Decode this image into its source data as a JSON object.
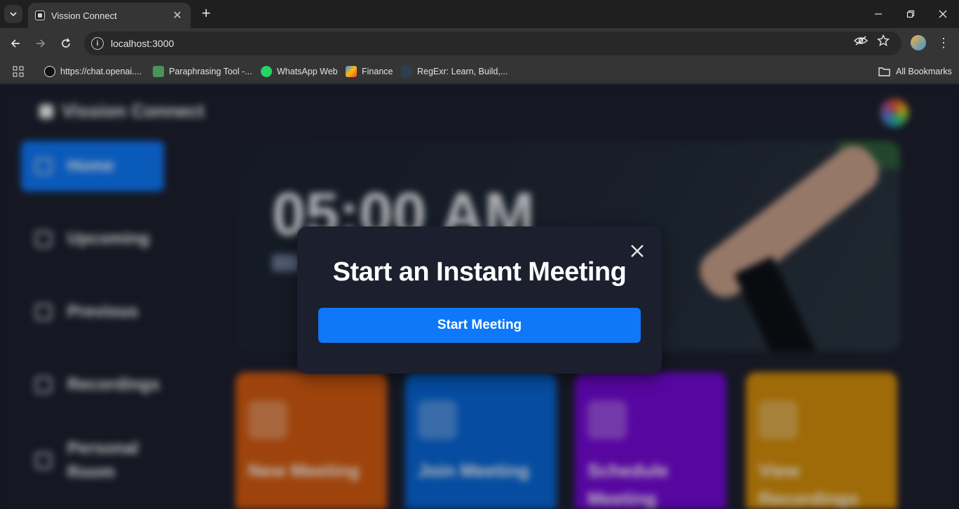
{
  "browser": {
    "tab_title": "Vission Connect",
    "url": "localhost:3000",
    "bookmarks": [
      {
        "label": "https://chat.openai....",
        "icon": "openai-icon"
      },
      {
        "label": "Paraphrasing Tool -...",
        "icon": "quillbot-icon"
      },
      {
        "label": "WhatsApp Web",
        "icon": "whatsapp-icon"
      },
      {
        "label": "Finance",
        "icon": "finance-icon"
      },
      {
        "label": "RegExr: Learn, Build,...",
        "icon": "regexr-icon"
      }
    ],
    "all_bookmarks_label": "All Bookmarks"
  },
  "app": {
    "brand": "Vission Connect",
    "sidebar": {
      "items": [
        {
          "label": "Home",
          "active": true
        },
        {
          "label": "Upcoming"
        },
        {
          "label": "Previous"
        },
        {
          "label": "Recordings"
        },
        {
          "label": "Personal Room"
        }
      ]
    },
    "hero": {
      "time": "05:00 AM"
    },
    "cards": [
      {
        "title": "New Meeting",
        "color": "#ff742e"
      },
      {
        "title": "Join Meeting",
        "color": "#0e78f9"
      },
      {
        "title": "Schedule Meeting",
        "color": "#830ef9"
      },
      {
        "title": "View Recordings",
        "color": "#f9a90e"
      }
    ]
  },
  "modal": {
    "title": "Start an Instant Meeting",
    "button_label": "Start Meeting"
  },
  "colors": {
    "background": "#1c1f2e",
    "accent": "#0e78f9"
  }
}
